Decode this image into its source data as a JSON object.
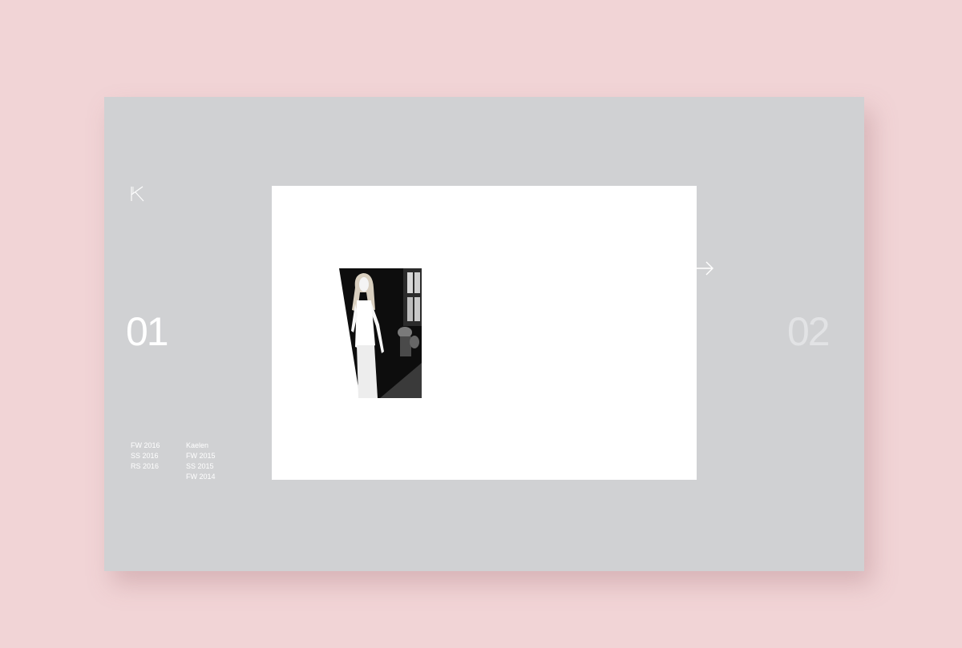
{
  "brand": {
    "logo_letter": "K",
    "logo_icon": "k-logo-icon"
  },
  "slides": {
    "current": "01",
    "next": "02"
  },
  "collections_left": [
    "FW 2016",
    "SS 2016",
    "RS 2016"
  ],
  "collections_right": [
    "Kaelen",
    "FW 2015",
    "SS 2015",
    "FW 2014"
  ],
  "navigation": {
    "next_icon": "arrow-right-icon"
  },
  "colors": {
    "backdrop": "#f1d4d6",
    "screen": "#d0d1d3",
    "slide": "#ffffff",
    "text": "#ffffff",
    "next_number": "#e2e3e5"
  }
}
